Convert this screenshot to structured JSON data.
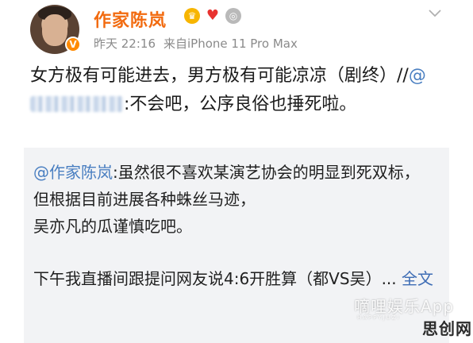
{
  "post": {
    "author": "作家陈岚",
    "time": "昨天 22:16",
    "source": "来自iPhone 11 Pro Max",
    "text_a": "女方极有可能进去，男方极有可能凉凉（剧终）//",
    "text_mention": "@",
    "text_b": ":不会吧，公序良俗也捶死啦。"
  },
  "icons": {
    "verified": "verified-badge-icon",
    "crown": "crown-badge-icon",
    "heart": "heart-badge-icon",
    "medal": "medal-badge-icon",
    "menu": "chevron-down-icon"
  },
  "quote": {
    "mention": "@作家陈岚",
    "line1": ":虽然很不喜欢某演艺协会的明显到死双标，",
    "line2": "但根据目前进展各种蛛丝马迹，",
    "line3": "吴亦凡的瓜谨慎吃吧。",
    "line4": "下午我直播间跟提问网友说4:6开胜算（都VS吴）...",
    "more": "全文"
  },
  "watermark": {
    "main": "嘀哩娱乐App",
    "sub": "HAPPYJUZI",
    "brand": "思创网"
  },
  "colors": {
    "author": "#f26b10",
    "link": "#3e6db5",
    "quote_bg": "#f2f3f5",
    "meta": "#8a8a8a"
  }
}
